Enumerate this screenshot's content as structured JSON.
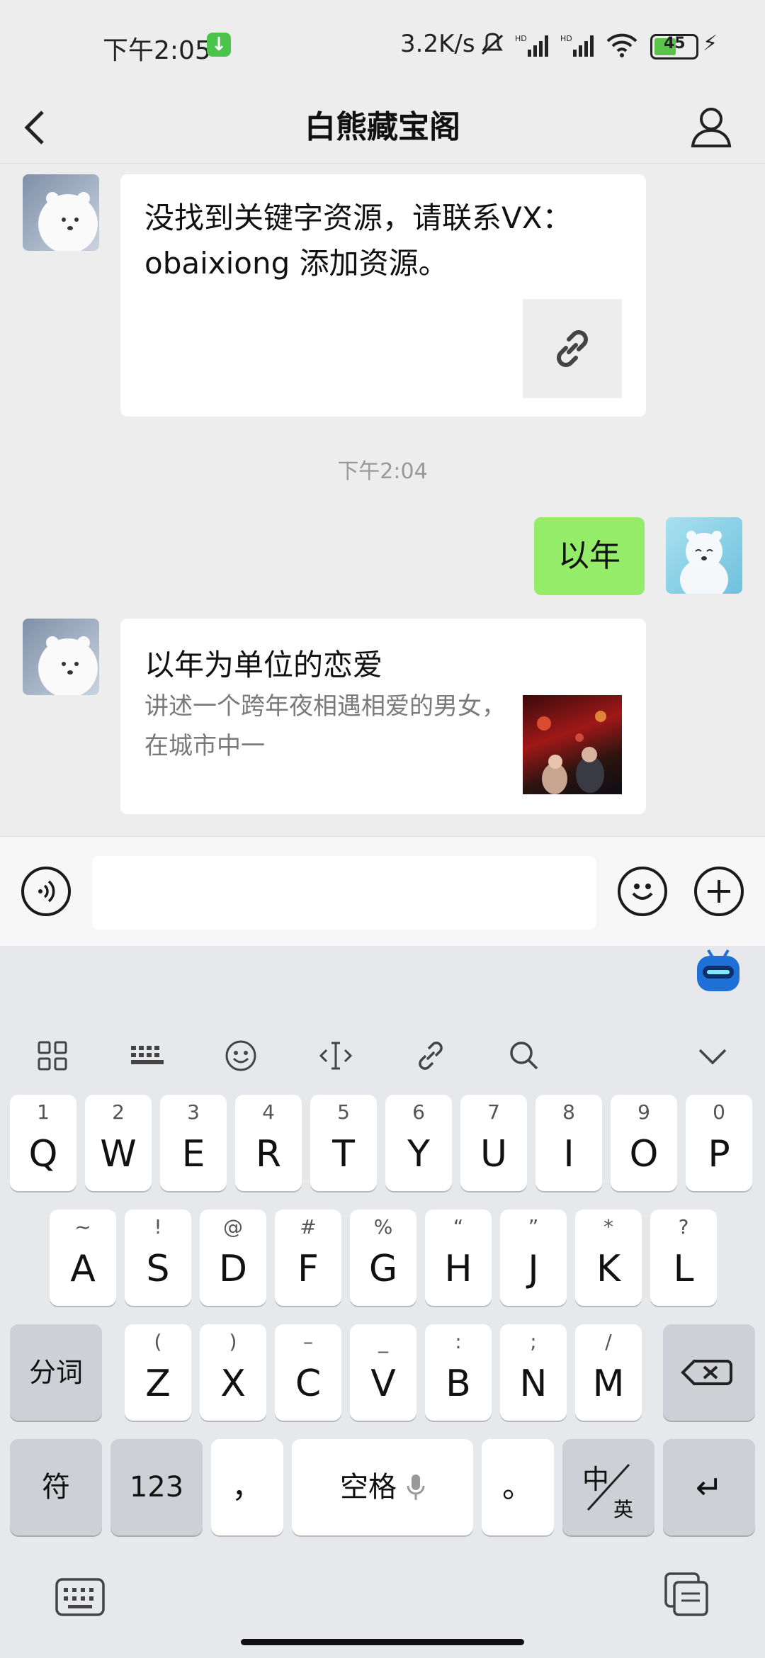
{
  "status_bar": {
    "time": "下午2:05",
    "net_speed": "3.2K/s",
    "signal_label": "HD",
    "battery": "45"
  },
  "header": {
    "title": "白熊藏宝阁"
  },
  "messages": {
    "bot_reply_1": {
      "text": "没找到关键字资源，请联系VX：obaixiong 添加资源。"
    },
    "timestamp": "下午2:04",
    "user_msg": {
      "text": "以年"
    },
    "bot_card": {
      "title": "以年为单位的恋爱",
      "desc": "讲述一个跨年夜相遇相爱的男女，在城市中一"
    }
  },
  "keyboard": {
    "row1": [
      {
        "main": "Q",
        "sub": "1"
      },
      {
        "main": "W",
        "sub": "2"
      },
      {
        "main": "E",
        "sub": "3"
      },
      {
        "main": "R",
        "sub": "4"
      },
      {
        "main": "T",
        "sub": "5"
      },
      {
        "main": "Y",
        "sub": "6"
      },
      {
        "main": "U",
        "sub": "7"
      },
      {
        "main": "I",
        "sub": "8"
      },
      {
        "main": "O",
        "sub": "9"
      },
      {
        "main": "P",
        "sub": "0"
      }
    ],
    "row2": [
      {
        "main": "A",
        "sub": "~"
      },
      {
        "main": "S",
        "sub": "!"
      },
      {
        "main": "D",
        "sub": "@"
      },
      {
        "main": "F",
        "sub": "#"
      },
      {
        "main": "G",
        "sub": "%"
      },
      {
        "main": "H",
        "sub": "“"
      },
      {
        "main": "J",
        "sub": "”"
      },
      {
        "main": "K",
        "sub": "*"
      },
      {
        "main": "L",
        "sub": "?"
      }
    ],
    "row3": [
      {
        "main": "Z",
        "sub": "("
      },
      {
        "main": "X",
        "sub": ")"
      },
      {
        "main": "C",
        "sub": "–"
      },
      {
        "main": "V",
        "sub": "_"
      },
      {
        "main": "B",
        "sub": ":"
      },
      {
        "main": "N",
        "sub": ";"
      },
      {
        "main": "M",
        "sub": "/"
      }
    ],
    "fenci": "分词",
    "fu": "符",
    "num": "123",
    "comma": "，",
    "space": "空格",
    "period": "。",
    "lang_top": "中",
    "lang_bottom": "英",
    "enter": "↵",
    "backspace": "⌫"
  }
}
